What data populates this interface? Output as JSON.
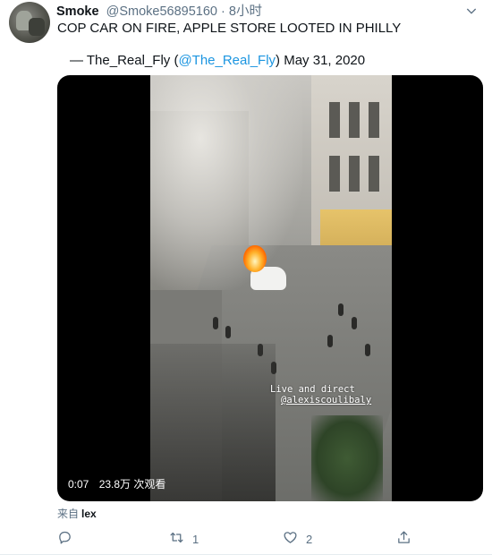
{
  "tweet": {
    "author_name": "Smoke",
    "author_handle": "@Smoke56895160",
    "separator": "·",
    "time_ago": "8小时",
    "text": "COP CAR ON FIRE, APPLE STORE LOOTED IN PHILLY",
    "attribution_prefix": "— The_Real_Fly (",
    "attribution_mention": "@The_Real_Fly",
    "attribution_suffix": ")",
    "attribution_date": "May 31, 2020"
  },
  "video": {
    "overlay_line1": "Live and direct",
    "overlay_line2": "@alexiscoulibaly",
    "duration": "0:07",
    "views": "23.8万 次观看"
  },
  "source": {
    "prefix": "来自",
    "app": "lex"
  },
  "actions": {
    "reply_icon": "reply-icon",
    "retweet_icon": "retweet-icon",
    "retweet_count": "1",
    "like_icon": "heart-icon",
    "like_count": "2",
    "share_icon": "share-icon"
  },
  "colors": {
    "link": "#1b95e0",
    "muted": "#5b7083",
    "text": "#0f1419"
  }
}
